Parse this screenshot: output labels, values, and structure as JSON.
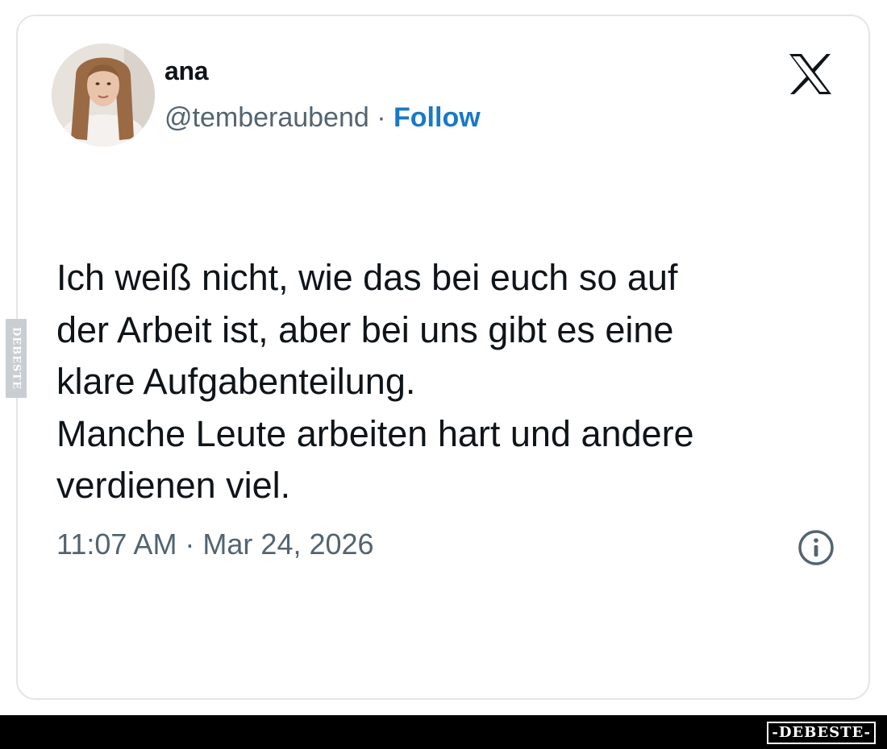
{
  "tweet": {
    "author_name": "ana",
    "handle": "@temberaubend",
    "separator": " · ",
    "follow_label": "Follow",
    "text_lines": [
      "Ich weiß nicht, wie das bei euch so auf",
      "der Arbeit ist, aber bei uns gibt es eine",
      "klare Aufgabenteilung.",
      "Manche Leute arbeiten hart und andere",
      "verdienen viel."
    ],
    "timestamp": "11:07 AM · Mar 24, 2026"
  },
  "icons": {
    "platform": "x-logo-icon",
    "info": "info-icon"
  },
  "watermark": {
    "label": "-DEBESTE-",
    "side_label": "DEBESTE"
  },
  "colors": {
    "text": "#0f1419",
    "secondary": "#536471",
    "follow": "#1a78c9",
    "border": "#e3e6e9"
  }
}
